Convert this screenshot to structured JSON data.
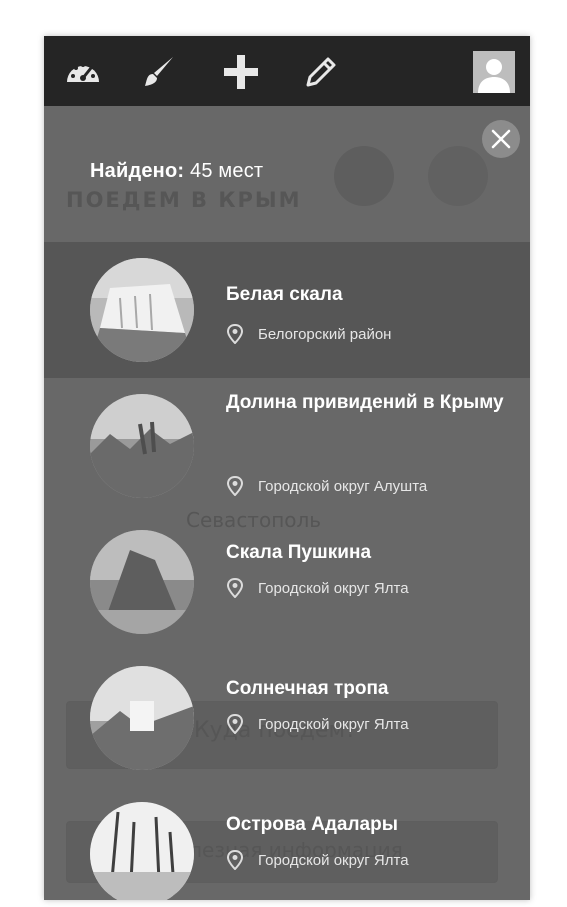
{
  "header": {
    "icons": [
      "dashboard-icon",
      "brush-icon",
      "plus-icon",
      "pencil-icon",
      "user-avatar-icon"
    ]
  },
  "background_map": {
    "brand_text": "ПОЕДЕМ В КРЫМ",
    "city_label": "Севастополь",
    "button_where": "Куда поедем?",
    "button_info": "Полезная информация"
  },
  "results": {
    "found_label": "Найдено:",
    "found_value": "45 мест"
  },
  "places": [
    {
      "title": "Белая скала",
      "location": "Белогорский район",
      "active": true
    },
    {
      "title": "Долина привидений в Крыму",
      "location": "Городской округ Алушта",
      "active": false
    },
    {
      "title": "Скала Пушкина",
      "location": "Городской округ Ялта",
      "active": false
    },
    {
      "title": "Солнечная тропа",
      "location": "Городской округ Ялта",
      "active": false
    },
    {
      "title": "Острова Адалары",
      "location": "Городской округ Ялта",
      "active": false
    }
  ],
  "colors": {
    "topbar": "#252525",
    "panel": "#6e6e6e",
    "active_row": "#565656",
    "text": "#ffffff"
  }
}
